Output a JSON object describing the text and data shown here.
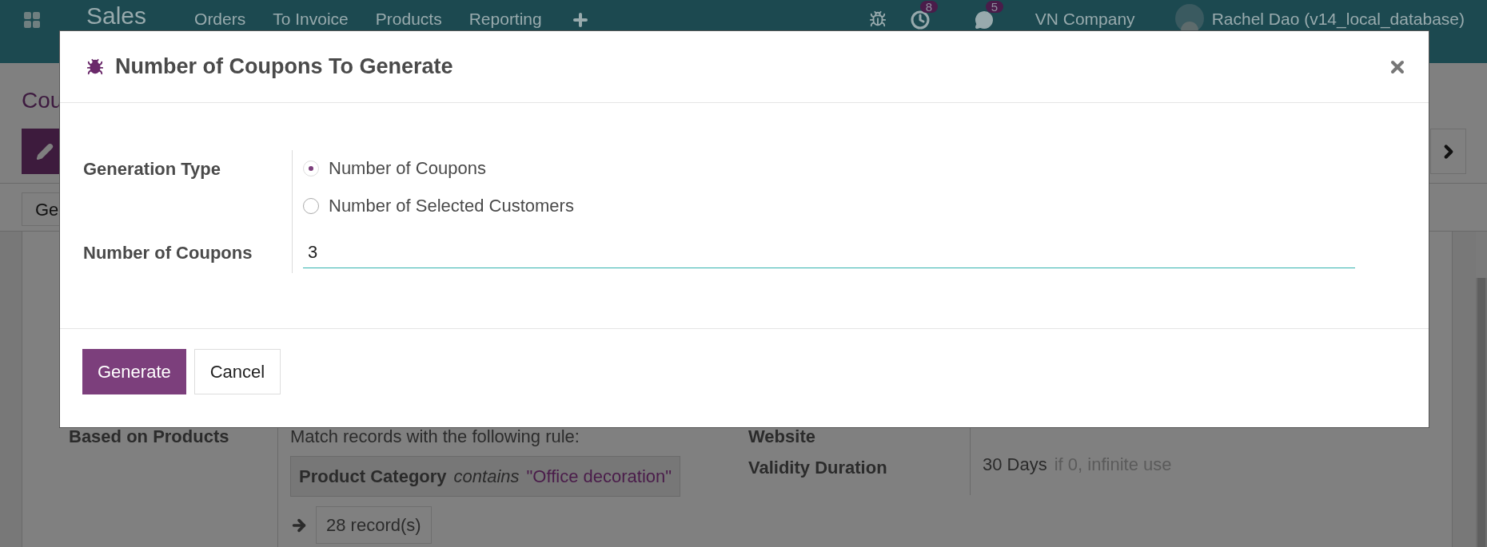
{
  "navbar": {
    "app_name": "Sales",
    "menu": [
      "Orders",
      "To Invoice",
      "Products",
      "Reporting"
    ],
    "activity_count": "8",
    "message_count": "5",
    "company": "VN Company",
    "user": "Rachel Dao (v14_local_database)"
  },
  "control_panel": {
    "title": "Cou"
  },
  "toolbar": {
    "button": "Ge"
  },
  "sheet": {
    "rule_label": "Based on Products",
    "rule_intro": "Match records with the following rule:",
    "rule_field": "Product Category",
    "rule_operator": "contains",
    "rule_value": "\"Office decoration\"",
    "records": "28 record(s)",
    "website_label": "Website",
    "validity_label": "Validity Duration",
    "validity_value": "30 Days",
    "validity_hint": "if 0, infinite use"
  },
  "dialog": {
    "title": "Number of Coupons To Generate",
    "generation_type_label": "Generation Type",
    "options": [
      {
        "label": "Number of Coupons",
        "selected": true
      },
      {
        "label": "Number of Selected Customers",
        "selected": false
      }
    ],
    "count_label": "Number of Coupons",
    "count_value": "3",
    "buttons": [
      {
        "label": "Generate",
        "kind": "primary"
      },
      {
        "label": "Cancel",
        "kind": "secondary"
      }
    ]
  }
}
